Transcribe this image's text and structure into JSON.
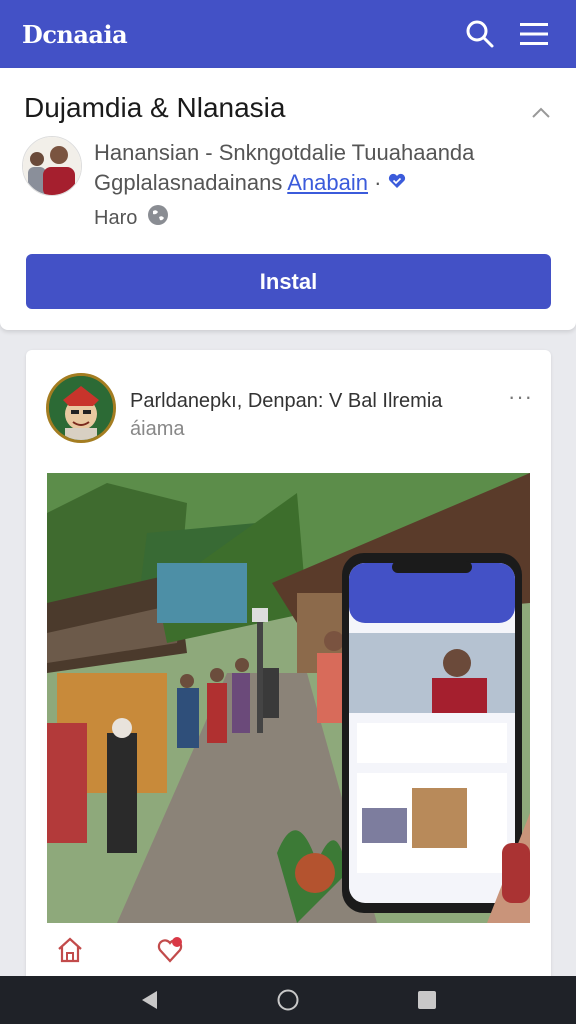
{
  "app": {
    "brand": "Dcnaaia"
  },
  "page": {
    "title": "Dujamdia & Nlanasia",
    "desc_line1": "Hanansian - Snkngotdalie Tuuahaanda",
    "desc_line2_text": "Ggplalasnadainans ",
    "desc_line2_link": "Anabain",
    "desc_line2_suffix": " ·",
    "meta_label": "Haro",
    "install_label": "Instal"
  },
  "post": {
    "author": "Parldanepkı, Denpan: V Bal Ilremia",
    "sub": "áiama"
  },
  "icons": {
    "search": "search-icon",
    "menu": "hamburger-menu-icon",
    "collapse": "chevron-up-icon",
    "globe": "globe-icon",
    "verified": "heart-badge-icon",
    "more": "more-dots-icon",
    "home": "home-icon",
    "like": "heart-icon",
    "back": "back-triangle-icon",
    "homeNav": "home-circle-icon",
    "recents": "recents-square-icon"
  },
  "colors": {
    "brand": "#4351c6",
    "navbar": "#1f2228",
    "link": "#3b5bdb"
  }
}
